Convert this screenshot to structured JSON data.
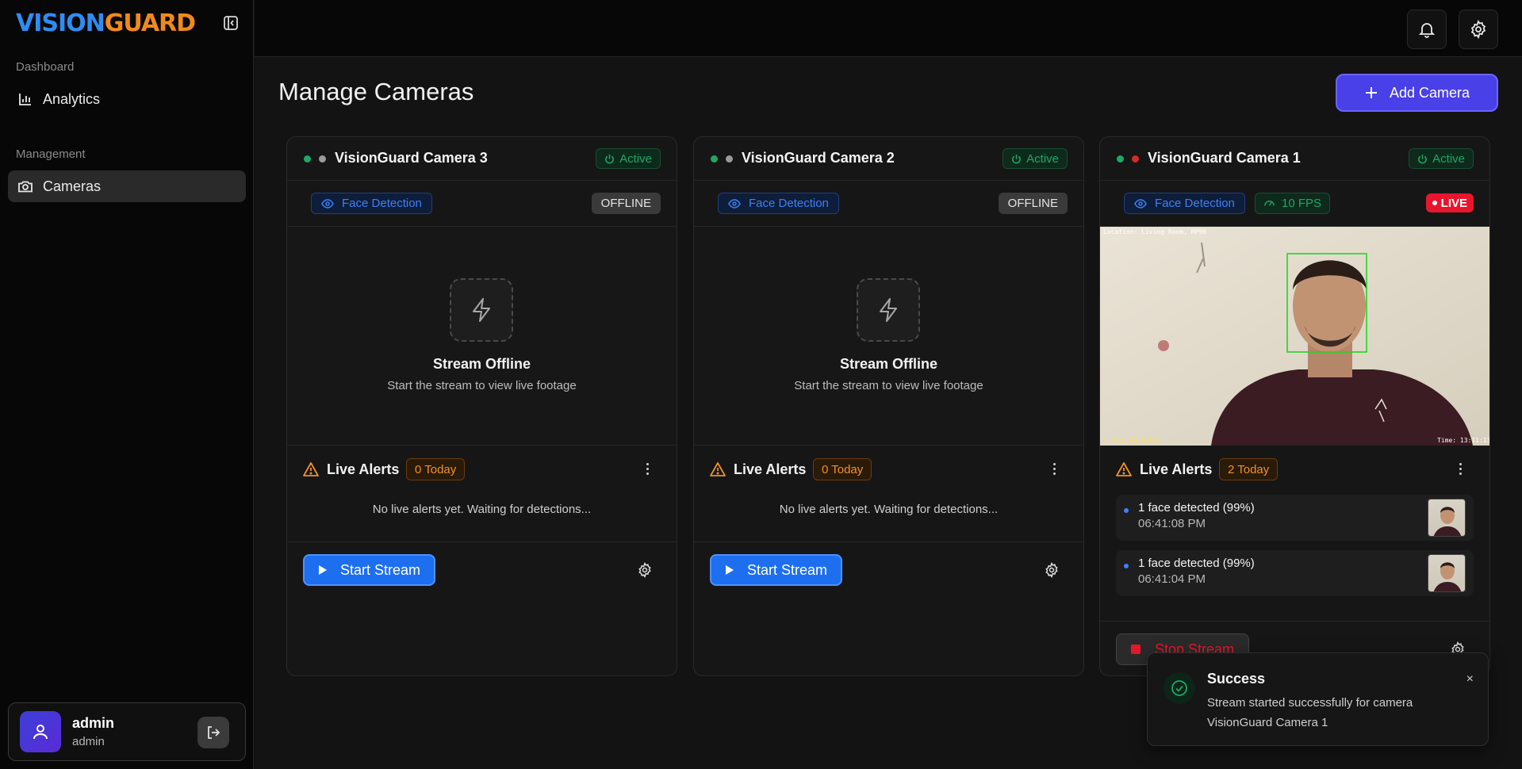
{
  "app": {
    "logo_part1": "VISION",
    "logo_part2": "GUARD"
  },
  "sidebar": {
    "sections": [
      {
        "label": "Dashboard",
        "items": [
          {
            "label": "Analytics",
            "icon": "bar-chart-icon"
          }
        ]
      },
      {
        "label": "Management",
        "items": [
          {
            "label": "Cameras",
            "icon": "camera-icon",
            "active": true
          }
        ]
      }
    ],
    "user": {
      "name": "admin",
      "role": "admin"
    }
  },
  "header": {
    "page_title": "Manage Cameras",
    "add_camera_label": "Add Camera"
  },
  "cameras": [
    {
      "name": "VisionGuard Camera 3",
      "status_label": "Active",
      "detection_label": "Face Detection",
      "stream_state": "OFFLINE",
      "offline_title": "Stream Offline",
      "offline_sub": "Start the stream to view live footage",
      "alerts_title": "Live Alerts",
      "alerts_today": "0 Today",
      "no_alerts": "No live alerts yet. Waiting for detections...",
      "action_label": "Start Stream"
    },
    {
      "name": "VisionGuard Camera 2",
      "status_label": "Active",
      "detection_label": "Face Detection",
      "stream_state": "OFFLINE",
      "offline_title": "Stream Offline",
      "offline_sub": "Start the stream to view live footage",
      "alerts_title": "Live Alerts",
      "alerts_today": "0 Today",
      "no_alerts": "No live alerts yet. Waiting for detections...",
      "action_label": "Start Stream"
    },
    {
      "name": "VisionGuard Camera 1",
      "status_label": "Active",
      "detection_label": "Face Detection",
      "fps_label": "10 FPS",
      "stream_state": "LIVE",
      "overlay_top": "Location: Living Room, RP96",
      "overlay_bottom_left": "1 Face detected",
      "overlay_bottom_right": "Time: 13:11:13",
      "alerts_title": "Live Alerts",
      "alerts_today": "2 Today",
      "alerts": [
        {
          "text": "1 face detected (99%)",
          "time": "06:41:08 PM"
        },
        {
          "text": "1 face detected (99%)",
          "time": "06:41:04 PM"
        }
      ],
      "action_label": "Stop Stream"
    }
  ],
  "toast": {
    "title": "Success",
    "message_line1": "Stream started successfully for camera",
    "message_line2": "VisionGuard Camera 1",
    "close_glyph": "×"
  },
  "colors": {
    "accent": "#4a40e8",
    "primary_button": "#1d6ff0",
    "success": "#1fa865",
    "live": "#e8162d",
    "warning": "#f0902a"
  }
}
